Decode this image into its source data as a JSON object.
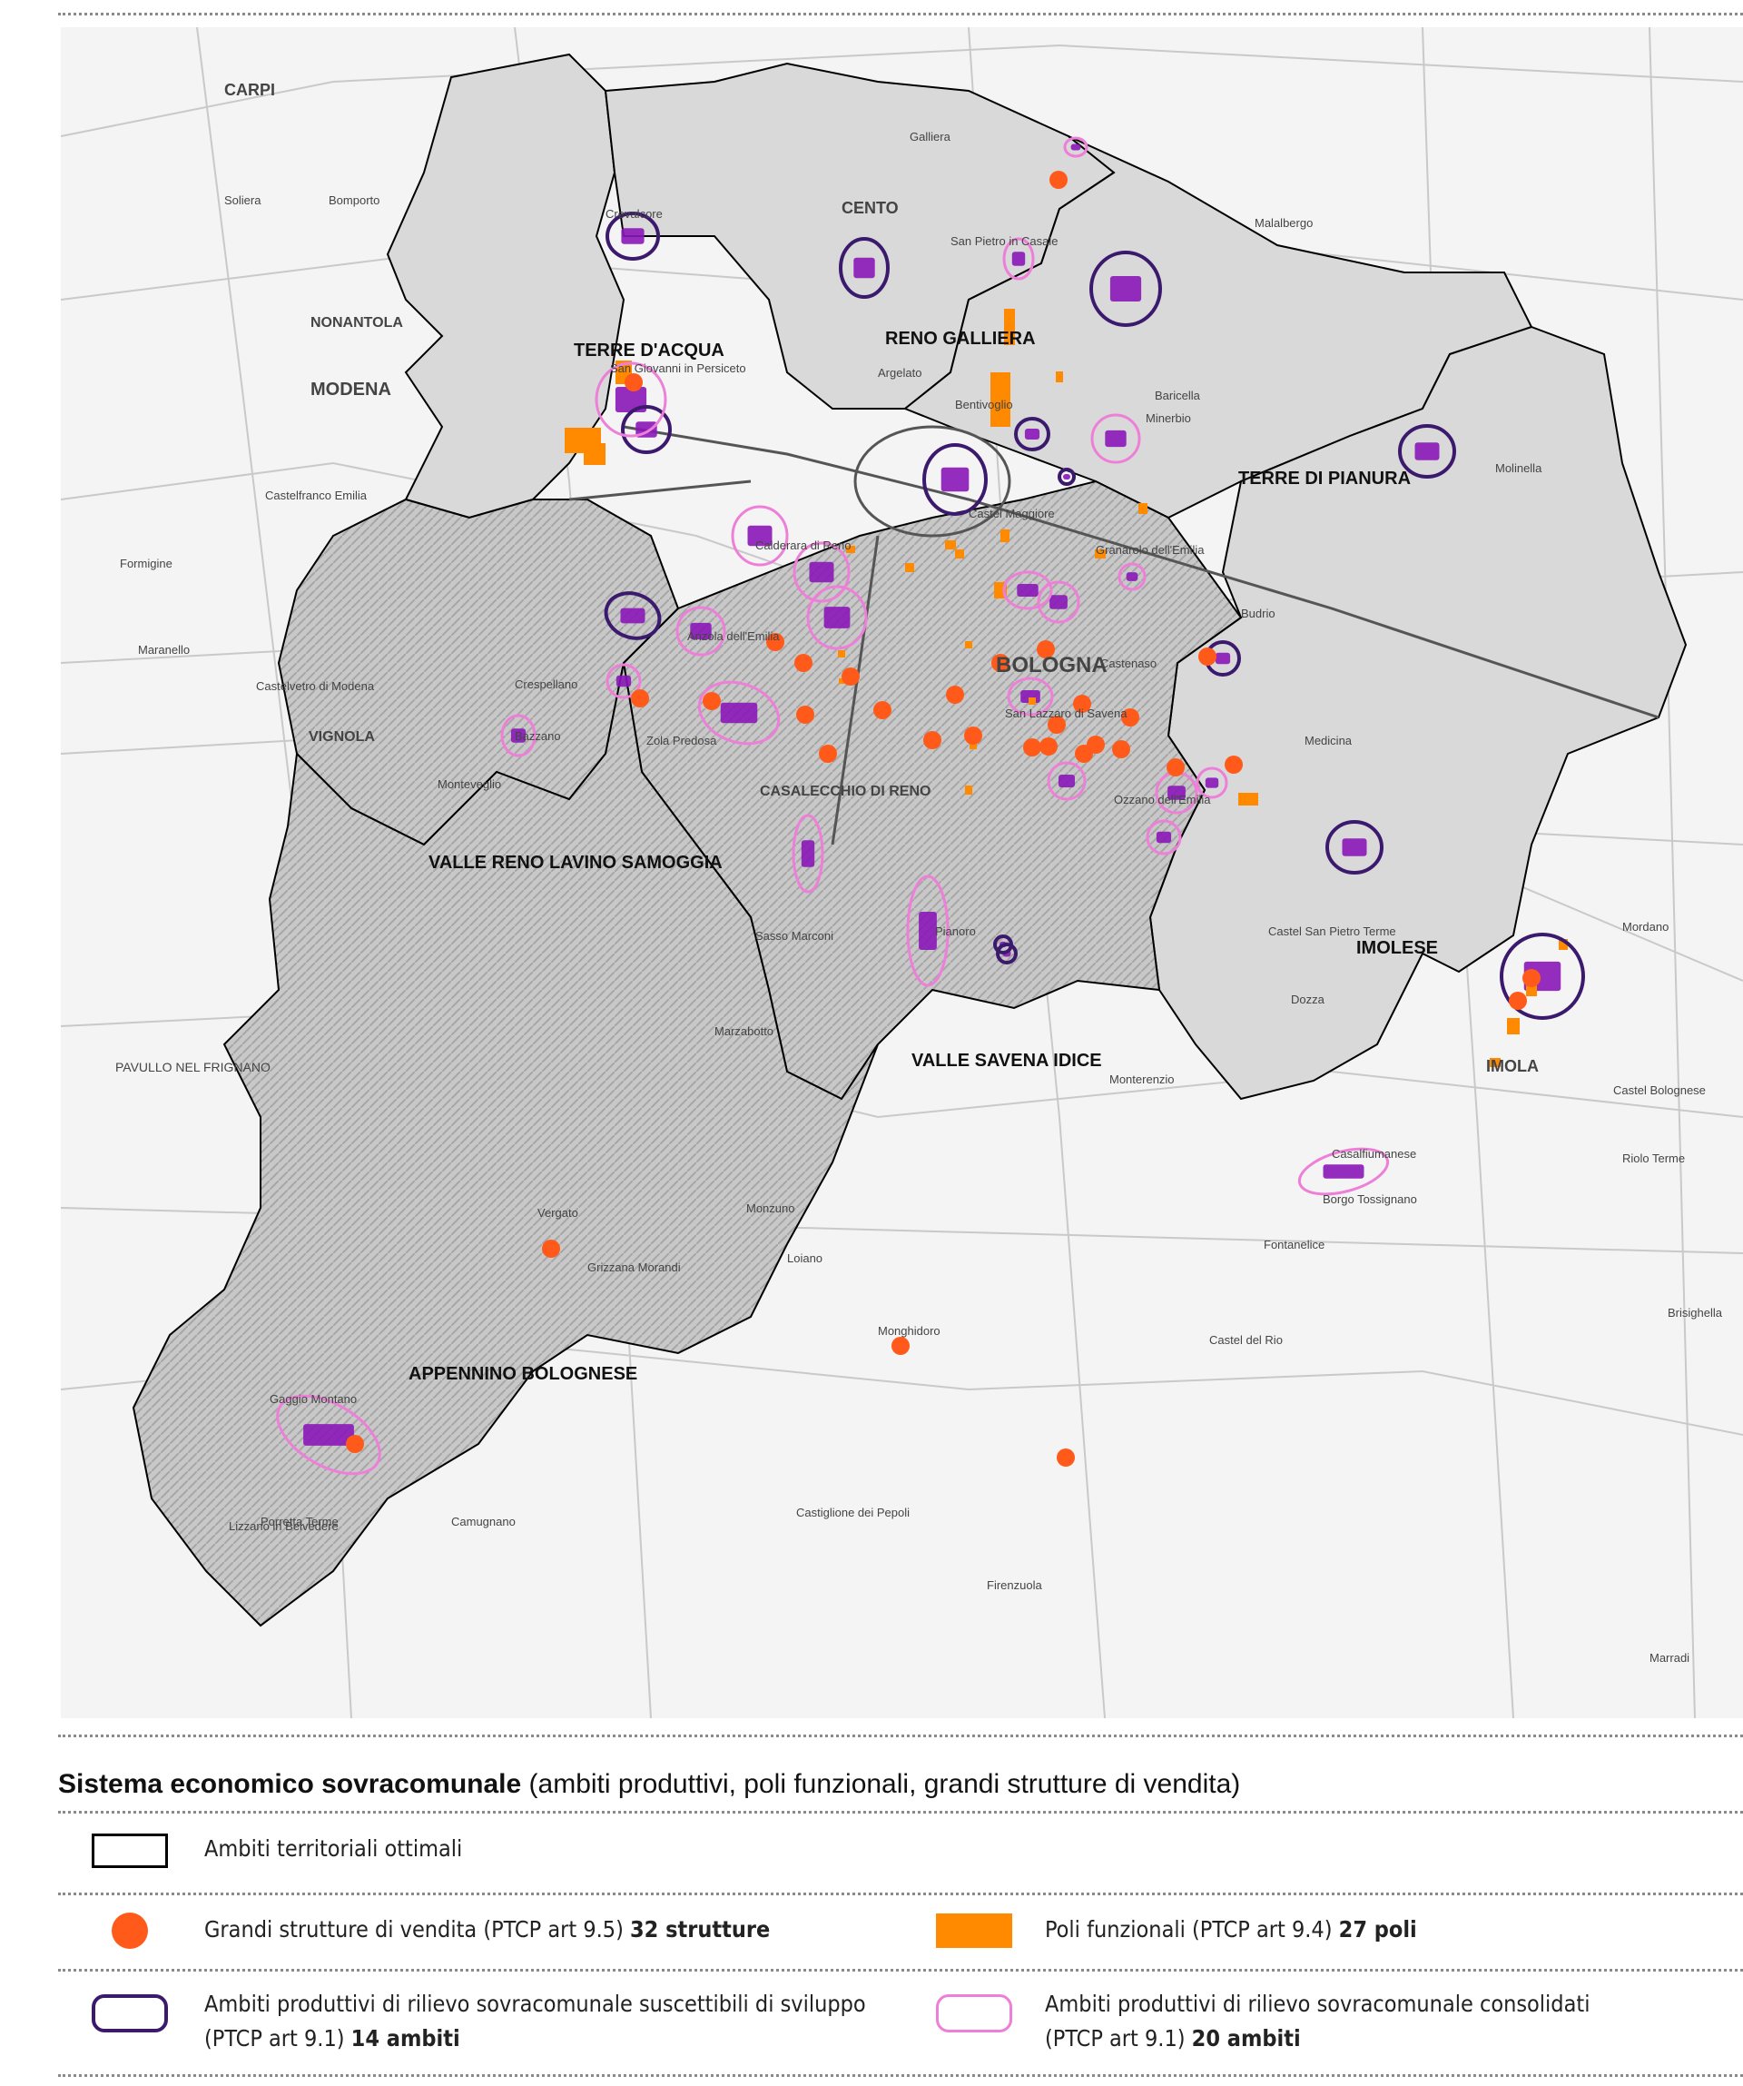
{
  "map": {
    "area_labels": [
      "TERRE D'ACQUA",
      "RENO GALLIERA",
      "TERRE DI PIANURA",
      "VALLE RENO LAVINO SAMOGGIA",
      "IMOLESE",
      "VALLE SAVENA IDICE",
      "APPENNINO BOLOGNESE"
    ],
    "city_labels": [
      "CARPI",
      "MODENA",
      "CENTO",
      "BOLOGNA",
      "IMOLA",
      "NONANTOLA",
      "VIGNOLA",
      "CASALECCHIO DI RENO",
      "PAVULLO NEL FRIGNANO",
      "Soliera",
      "Bomporto",
      "Castelfranco Emilia",
      "Formigine",
      "Maranello",
      "Castelvetro di Modena",
      "Zola Predosa",
      "Sasso Marconi",
      "Marzabotto",
      "Vergato",
      "Porretta Terme",
      "Monzuno",
      "Loiano",
      "Pianoro",
      "Monghidoro",
      "Budrio",
      "Medicina",
      "Minerbio",
      "Molinella",
      "Argelato",
      "Bentivoglio",
      "Castel Maggiore",
      "Granarolo dell'Emilia",
      "Ozzano dell'Emilia",
      "Castel San Pietro Terme",
      "Dozza",
      "Mordano",
      "Castel Bolognese",
      "Riolo Terme",
      "Borgo Tossignano",
      "Casalfiumanese",
      "Firenzuola",
      "Marradi",
      "Brisighella",
      "Castiglione dei Pepoli",
      "Camugnano",
      "Gaggio Montano",
      "Lizzano in Belvedere",
      "Crevalcore",
      "San Giovanni in Persiceto",
      "Calderara di Reno",
      "Anzola dell'Emilia",
      "Bazzano",
      "Crespellano",
      "Monteveglio",
      "San Pietro in Casale",
      "Galliera",
      "Malalbergo",
      "Baricella",
      "Castenaso",
      "San Lazzaro di Savena",
      "Monterenzio",
      "Castel del Rio",
      "Fontanelice",
      "Grizzana Morandi"
    ],
    "colors": {
      "boundary": "#000000",
      "area_fill": "#d9d9d9",
      "hill_fill": "#b8b8b8",
      "retail": "#ff5a1a",
      "functional_pole": "#ff8a00",
      "development": "#3b1a6e",
      "consolidated": "#ee7fd8",
      "industrial_area": "#8a17b8"
    }
  },
  "legend": {
    "title_bold": "Sistema economico sovracomunale",
    "title_rest": " (ambiti produttivi, poli funzionali, grandi strutture di vendita)",
    "items": [
      {
        "text": "Ambiti territoriali ottimali",
        "bold": ""
      },
      {
        "text": "Grandi strutture di vendita (PTCP art 9.5) ",
        "bold": "32 strutture"
      },
      {
        "text": "Poli funzionali (PTCP art 9.4) ",
        "bold": "27 poli"
      },
      {
        "text": "Ambiti produttivi di rilievo sovracomunale suscettibili di sviluppo",
        "line2": "(PTCP art 9.1) ",
        "bold": "14 ambiti"
      },
      {
        "text": "Ambiti produttivi di rilievo sovracomunale consolidati",
        "line2": "(PTCP art 9.1) ",
        "bold": "20 ambiti"
      }
    ]
  }
}
